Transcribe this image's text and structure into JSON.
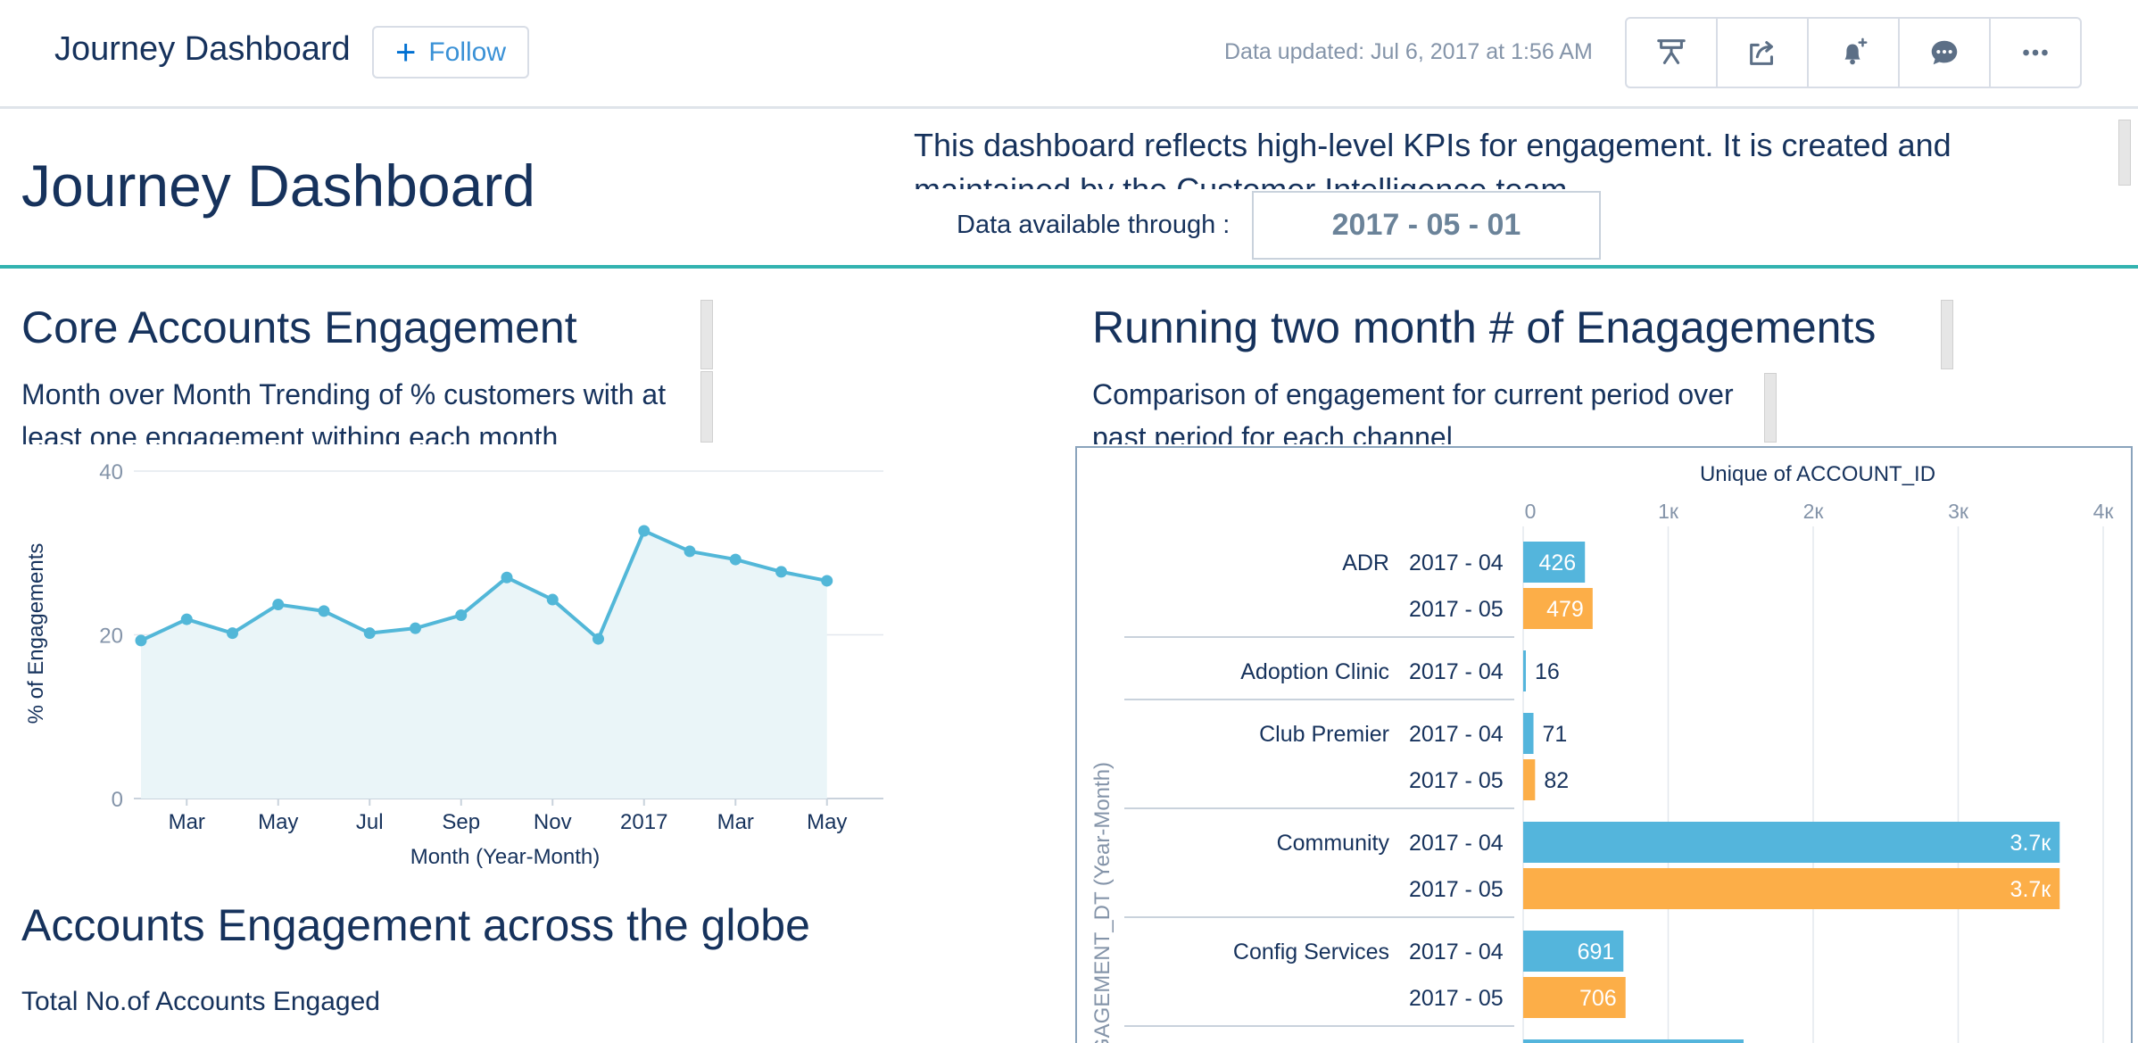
{
  "header": {
    "title": "Journey Dashboard",
    "follow_label": "Follow",
    "data_updated": "Data updated: Jul 6, 2017 at 1:56 AM",
    "actions": [
      "present-icon",
      "share-icon",
      "subscribe-bell-icon",
      "chat-icon",
      "more-icon"
    ]
  },
  "dashboard": {
    "title": "Journey Dashboard",
    "description": "This dashboard reflects high-level KPIs for engagement. It is created and maintained by the Customer Intelligence team.",
    "data_through_label": "Data available through :",
    "data_through_value": "2017 - 05 - 01"
  },
  "left": {
    "title": "Core Accounts Engagement",
    "subtitle": "Month over Month Trending of % customers with at least one engagement withing each month",
    "globe_title": "Accounts Engagement across the globe",
    "globe_subtitle": "Total No.of Accounts Engaged"
  },
  "right": {
    "title": "Running two month # of Enagagements",
    "subtitle": "Comparison of engagement for current period over past period for each channel"
  },
  "colors": {
    "accent": "#0070d2",
    "teal": "#33b3b0",
    "line": "#52b7d8",
    "area": "#eaf5f8",
    "bar_blue": "#54b5dc",
    "bar_orange": "#fcae48",
    "text": "#16325c",
    "axis_text": "#8494a9"
  },
  "chart_data": [
    {
      "type": "area",
      "ylabel": "% of Engagements",
      "xlabel": "Month (Year-Month)",
      "ylim": [
        0,
        40
      ],
      "yticks": [
        "0",
        "20",
        "40"
      ],
      "xticks": [
        "Mar",
        "May",
        "Jul",
        "Sep",
        "Nov",
        "2017",
        "Mar",
        "May"
      ],
      "x": [
        "2016-01",
        "2016-02",
        "2016-03",
        "2016-04",
        "2016-05",
        "2016-06",
        "2016-07",
        "2016-08",
        "2016-09",
        "2016-10",
        "2016-11",
        "2016-12",
        "2017-01",
        "2017-02",
        "2017-03",
        "2017-04",
        "2017-05"
      ],
      "values": [
        19.3,
        21.9,
        20.2,
        23.7,
        22.9,
        20.2,
        20.8,
        22.4,
        27.0,
        24.3,
        19.5,
        32.7,
        30.2,
        29.2,
        27.7,
        26.6,
        null
      ],
      "grid": true
    },
    {
      "type": "bar",
      "orientation": "horizontal",
      "xlabel": "Unique of ACCOUNT_ID",
      "ylabel": "GAGEMENT_DT (Year-Month)",
      "xlim": [
        0,
        4000
      ],
      "xticks": [
        "0",
        "1к",
        "2к",
        "3к",
        "4к"
      ],
      "groups": [
        {
          "name": "ADR",
          "rows": [
            {
              "period": "2017 - 04",
              "value": 426,
              "label": "426"
            },
            {
              "period": "2017 - 05",
              "value": 479,
              "label": "479"
            }
          ]
        },
        {
          "name": "Adoption Clinic",
          "rows": [
            {
              "period": "2017 - 04",
              "value": 16,
              "label": "16"
            }
          ]
        },
        {
          "name": "Club Premier",
          "rows": [
            {
              "period": "2017 - 04",
              "value": 71,
              "label": "71"
            },
            {
              "period": "2017 - 05",
              "value": 82,
              "label": "82"
            }
          ]
        },
        {
          "name": "Community",
          "rows": [
            {
              "period": "2017 - 04",
              "value": 3700,
              "label": "3.7к"
            },
            {
              "period": "2017 - 05",
              "value": 3700,
              "label": "3.7к"
            }
          ]
        },
        {
          "name": "Config Services",
          "rows": [
            {
              "period": "2017 - 04",
              "value": 691,
              "label": "691"
            },
            {
              "period": "2017 - 05",
              "value": 706,
              "label": "706"
            }
          ]
        },
        {
          "name": "",
          "rows": [
            {
              "period": "",
              "value": 1520,
              "label": ""
            }
          ]
        }
      ]
    }
  ]
}
